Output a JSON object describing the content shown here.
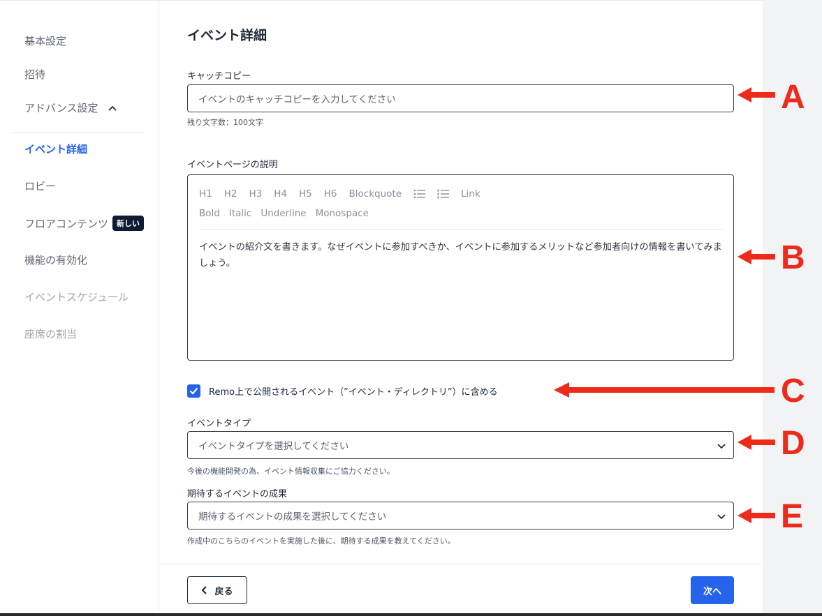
{
  "sidebar": {
    "items": [
      {
        "label": "基本設定"
      },
      {
        "label": "招待"
      },
      {
        "label": "アドバンス設定"
      },
      {
        "label": "イベント詳細"
      },
      {
        "label": "ロビー"
      },
      {
        "label": "フロアコンテンツ",
        "badge": "新しい"
      },
      {
        "label": "機能の有効化"
      },
      {
        "label": "イベントスケジュール"
      },
      {
        "label": "座席の割当"
      }
    ]
  },
  "main": {
    "title": "イベント詳細",
    "catchcopy": {
      "label": "キャッチコピー",
      "placeholder": "イベントのキャッチコピーを入力してください",
      "helper": "残り文字数：100文字"
    },
    "description": {
      "label": "イベントページの説明",
      "toolbar_row1": [
        "H1",
        "H2",
        "H3",
        "H4",
        "H5",
        "H6",
        "Blockquote"
      ],
      "toolbar_link": "Link",
      "toolbar_row2": [
        "Bold",
        "Italic",
        "Underline",
        "Monospace"
      ],
      "text": "イベントの紹介文を書きます。なぜイベントに参加すべきか、イベントに参加するメリットなど参加者向けの情報を書いてみましょう。"
    },
    "directory_checkbox": {
      "label": "Remo上で公開されるイベント（”イベント・ディレクトリ”）に含める",
      "checked": true
    },
    "event_type": {
      "label": "イベントタイプ",
      "placeholder": "イベントタイプを選択してください",
      "helper": "今後の機能開発の為、イベント情報収集にご協力ください。"
    },
    "outcome": {
      "label": "期待するイベントの成果",
      "placeholder": "期待するイベントの成果を選択してください",
      "helper": "作成中のこちらのイベントを実施した後に、期待する成果を教えてください。"
    }
  },
  "footer": {
    "back_label": "戻る",
    "next_label": "次へ"
  },
  "annotations": [
    "A",
    "B",
    "C",
    "D",
    "E"
  ],
  "colors": {
    "accent": "#2563eb",
    "annotation": "#ee2a1b",
    "badge_bg": "#0f1b33"
  }
}
